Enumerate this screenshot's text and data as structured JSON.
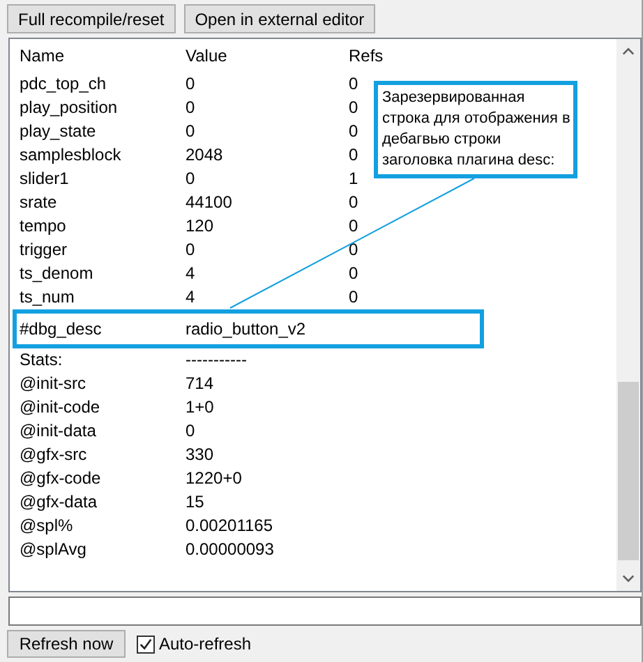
{
  "toolbar": {
    "buttons": [
      "Full recompile/reset",
      "Open in external editor"
    ]
  },
  "table": {
    "columns": [
      "Name",
      "Value",
      "Refs"
    ],
    "rows": [
      {
        "name": "pdc_top_ch",
        "value": "0",
        "refs": "0",
        "highlighted": false
      },
      {
        "name": "play_position",
        "value": "0",
        "refs": "0",
        "highlighted": false
      },
      {
        "name": "play_state",
        "value": "0",
        "refs": "0",
        "highlighted": false
      },
      {
        "name": "samplesblock",
        "value": "2048",
        "refs": "0",
        "highlighted": false
      },
      {
        "name": "slider1",
        "value": "0",
        "refs": "1",
        "highlighted": false
      },
      {
        "name": "srate",
        "value": "44100",
        "refs": "0",
        "highlighted": false
      },
      {
        "name": "tempo",
        "value": "120",
        "refs": "0",
        "highlighted": false
      },
      {
        "name": "trigger",
        "value": "0",
        "refs": "0",
        "highlighted": false
      },
      {
        "name": "ts_denom",
        "value": "4",
        "refs": "0",
        "highlighted": false
      },
      {
        "name": "ts_num",
        "value": "4",
        "refs": "0",
        "highlighted": false
      },
      {
        "name": "#dbg_desc",
        "value": "radio_button_v2",
        "refs": "",
        "highlighted": true
      }
    ],
    "stats": [
      {
        "name": "Stats:",
        "value": "-----------"
      },
      {
        "name": "@init-src",
        "value": "714"
      },
      {
        "name": "@init-code",
        "value": "1+0"
      },
      {
        "name": "@init-data",
        "value": "0"
      },
      {
        "name": "@gfx-src",
        "value": "330"
      },
      {
        "name": "@gfx-code",
        "value": "1220+0"
      },
      {
        "name": "@gfx-data",
        "value": "15"
      },
      {
        "name": "@spl%",
        "value": "0.00201165"
      },
      {
        "name": "@splAvg",
        "value": "0.00000093"
      }
    ]
  },
  "annotation": {
    "text": "Зарезервированная строка для отображения в дебагвью строки заголовка плагина desc:"
  },
  "bottom_bar": {
    "button": "Refresh now",
    "auto_refresh": {
      "label": "Auto-refresh",
      "checked": true
    }
  }
}
